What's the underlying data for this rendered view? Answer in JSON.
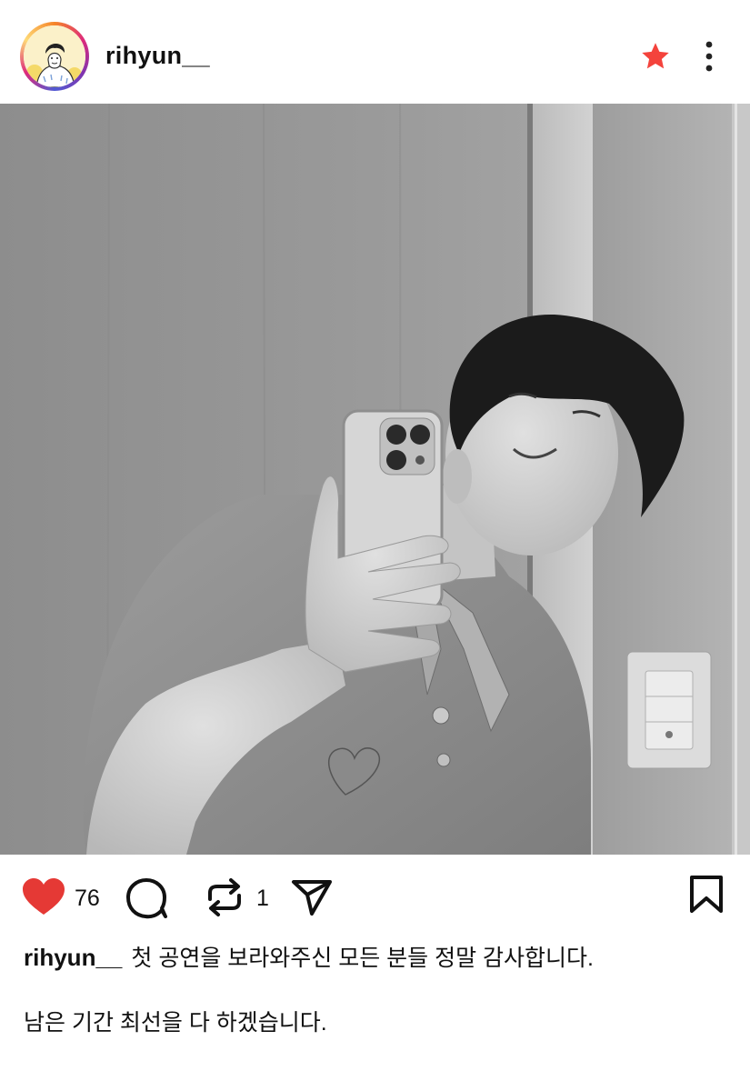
{
  "post": {
    "username": "rihyun__",
    "likes": "76",
    "reposts": "1",
    "caption_line1": "첫 공연을 보라와주신 모든 분들 정말 감사합니다.",
    "caption_line2": "남은 기간 최선을 다 하겠습니다."
  },
  "colors": {
    "like": "#e53935",
    "star": "#f4433c",
    "text": "#111111"
  },
  "icons": [
    "heart-icon",
    "comment-icon",
    "repost-icon",
    "send-icon",
    "bookmark-icon",
    "star-icon",
    "more-icon"
  ]
}
